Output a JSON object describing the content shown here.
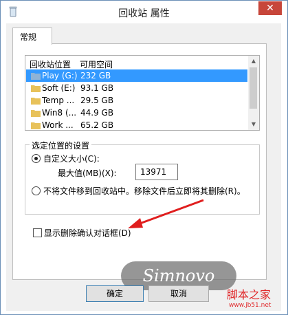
{
  "window": {
    "title": "回收站 属性",
    "close_glyph": "✕"
  },
  "tabs": [
    {
      "label": "常规"
    }
  ],
  "list": {
    "headers": {
      "location": "回收站位置",
      "space": "可用空间"
    },
    "rows": [
      {
        "name": "Play (G:)",
        "space": "232 GB"
      },
      {
        "name": "Soft (E:)",
        "space": "93.1 GB"
      },
      {
        "name": "Temp ...",
        "space": "29.5 GB"
      },
      {
        "name": "Win8 (...",
        "space": "44.9 GB"
      },
      {
        "name": "Work ...",
        "space": "65.2 GB"
      }
    ]
  },
  "settings": {
    "group_title": "选定位置的设置",
    "custom_size_label": "自定义大小(C):",
    "max_label": "最大值(MB)(X):",
    "max_value": "13971",
    "no_move_label": "不将文件移到回收站中。移除文件后立即将其删除(R)。"
  },
  "confirm_checkbox_label": "显示删除确认对话框(D)",
  "buttons": {
    "ok": "确定",
    "cancel": "取消"
  },
  "watermark": "Simnovo",
  "brand": {
    "name": "脚本之家",
    "url": "www.jb51.net"
  },
  "colors": {
    "selection": "#3399ff",
    "arrow": "#e01e1e",
    "close": "#c7463a"
  },
  "icons": {
    "title": "recycle-bin-icon",
    "folder": "folder-icon",
    "arrow": "red-arrow-annotation"
  }
}
